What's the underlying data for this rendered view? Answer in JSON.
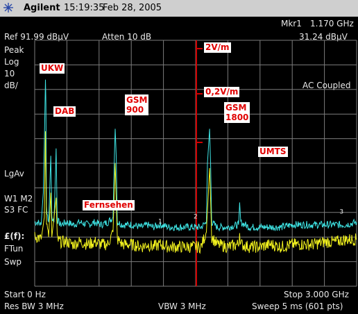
{
  "titlebar": {
    "brand": "Agilent",
    "time": "15:19:35",
    "date": "Feb 28, 2005"
  },
  "header": {
    "marker_label": "Mkr1",
    "marker_freq": "1.170 GHz",
    "ref_level": "Ref 91.99 dBµV",
    "atten": "Atten 10 dB",
    "marker_level": "31.24 dBµV"
  },
  "left_panel": {
    "detector": "Peak",
    "scale_type": "Log",
    "scale_value": "10",
    "scale_unit": "dB/",
    "average": "LgAv",
    "trace_line1": "W1  M2",
    "trace_line2": "S3  FC",
    "func_label": "£(f):",
    "ftun": "FTun",
    "swp": "Swp"
  },
  "status": {
    "coupling": "AC Coupled"
  },
  "footer": {
    "start": "Start 0 Hz",
    "stop": "Stop 3.000 GHz",
    "res_bw": "Res BW 3 MHz",
    "vbw": "VBW 3 MHz",
    "sweep": "Sweep 5 ms (601 pts)"
  },
  "annotations": {
    "ukw": "UKW",
    "dab": "DAB",
    "gsm900_line1": "GSM",
    "gsm900_line2": "900",
    "gsm1800_line1": "GSM",
    "gsm1800_line2": "1800",
    "umts": "UMTS",
    "fernsehen": "Fernsehen",
    "scale_2v": "2V/m",
    "scale_02v": "0,2V/m"
  },
  "markers": [
    "1",
    "2",
    "3"
  ],
  "colors": {
    "background": "#000000",
    "grid": "#7d7d7d",
    "trace_cyan": "#3fe6e6",
    "trace_yellow": "#f2f21e",
    "scale_line": "#d00000",
    "annotation_text": "#e00000",
    "annotation_bg": "#ffffff",
    "text": "#e8e8e8"
  },
  "chart_data": {
    "type": "line",
    "xlabel": "",
    "ylabel": "",
    "xlim": [
      0,
      3.0
    ],
    "x_unit": "GHz",
    "ylim": [
      -8.01,
      91.99
    ],
    "y_unit": "dBµV",
    "grid": true,
    "series": [
      {
        "color": "#3fe6e6",
        "points": [
          [
            0.0,
            18
          ],
          [
            0.03,
            18
          ],
          [
            0.06,
            17
          ],
          [
            0.08,
            30
          ],
          [
            0.09,
            50
          ],
          [
            0.1,
            76
          ],
          [
            0.105,
            66
          ],
          [
            0.11,
            24
          ],
          [
            0.13,
            18
          ],
          [
            0.15,
            45
          ],
          [
            0.16,
            20
          ],
          [
            0.18,
            18
          ],
          [
            0.2,
            48
          ],
          [
            0.21,
            19
          ],
          [
            0.24,
            17
          ],
          [
            0.3,
            18
          ],
          [
            0.36,
            17
          ],
          [
            0.42,
            18
          ],
          [
            0.5,
            17
          ],
          [
            0.56,
            18
          ],
          [
            0.62,
            17
          ],
          [
            0.68,
            18
          ],
          [
            0.73,
            20
          ],
          [
            0.74,
            40
          ],
          [
            0.75,
            56
          ],
          [
            0.76,
            45
          ],
          [
            0.77,
            18
          ],
          [
            0.82,
            17
          ],
          [
            0.9,
            17
          ],
          [
            1.0,
            16
          ],
          [
            1.05,
            17
          ],
          [
            1.1,
            16
          ],
          [
            1.17,
            17
          ],
          [
            1.25,
            16
          ],
          [
            1.35,
            16
          ],
          [
            1.45,
            16
          ],
          [
            1.55,
            16
          ],
          [
            1.6,
            18
          ],
          [
            1.61,
            42
          ],
          [
            1.63,
            56
          ],
          [
            1.64,
            40
          ],
          [
            1.65,
            18
          ],
          [
            1.7,
            16
          ],
          [
            1.8,
            16
          ],
          [
            1.9,
            17
          ],
          [
            1.91,
            25
          ],
          [
            1.92,
            18
          ],
          [
            2.0,
            16
          ],
          [
            2.1,
            16
          ],
          [
            2.2,
            16
          ],
          [
            2.3,
            16
          ],
          [
            2.4,
            17
          ],
          [
            2.5,
            17
          ],
          [
            2.6,
            17
          ],
          [
            2.7,
            17
          ],
          [
            2.8,
            17
          ],
          [
            2.9,
            17
          ],
          [
            3.0,
            18
          ]
        ]
      },
      {
        "color": "#f2f21e",
        "points": [
          [
            0.0,
            12
          ],
          [
            0.03,
            12
          ],
          [
            0.06,
            11
          ],
          [
            0.09,
            20
          ],
          [
            0.1,
            55
          ],
          [
            0.11,
            18
          ],
          [
            0.13,
            12
          ],
          [
            0.15,
            30
          ],
          [
            0.16,
            12
          ],
          [
            0.2,
            28
          ],
          [
            0.21,
            11
          ],
          [
            0.24,
            10
          ],
          [
            0.3,
            10
          ],
          [
            0.36,
            9
          ],
          [
            0.42,
            10
          ],
          [
            0.5,
            9
          ],
          [
            0.56,
            10
          ],
          [
            0.62,
            9
          ],
          [
            0.68,
            9
          ],
          [
            0.73,
            14
          ],
          [
            0.75,
            42
          ],
          [
            0.77,
            11
          ],
          [
            0.82,
            9
          ],
          [
            0.9,
            9
          ],
          [
            1.0,
            8
          ],
          [
            1.05,
            9
          ],
          [
            1.1,
            8
          ],
          [
            1.17,
            9
          ],
          [
            1.25,
            8
          ],
          [
            1.35,
            8
          ],
          [
            1.45,
            8
          ],
          [
            1.55,
            8
          ],
          [
            1.6,
            14
          ],
          [
            1.63,
            40
          ],
          [
            1.65,
            12
          ],
          [
            1.7,
            9
          ],
          [
            1.8,
            8
          ],
          [
            1.9,
            9
          ],
          [
            1.91,
            14
          ],
          [
            1.92,
            9
          ],
          [
            2.0,
            8
          ],
          [
            2.1,
            8
          ],
          [
            2.2,
            9
          ],
          [
            2.3,
            8
          ],
          [
            2.4,
            9
          ],
          [
            2.5,
            9
          ],
          [
            2.6,
            9
          ],
          [
            2.7,
            10
          ],
          [
            2.8,
            10
          ],
          [
            2.9,
            11
          ],
          [
            3.0,
            11
          ]
        ]
      }
    ],
    "markers": [
      {
        "label": "1",
        "x": 1.17,
        "y": 17
      },
      {
        "label": "2",
        "x": 1.5,
        "y": 19
      },
      {
        "label": "3",
        "x": 2.86,
        "y": 21
      }
    ]
  }
}
